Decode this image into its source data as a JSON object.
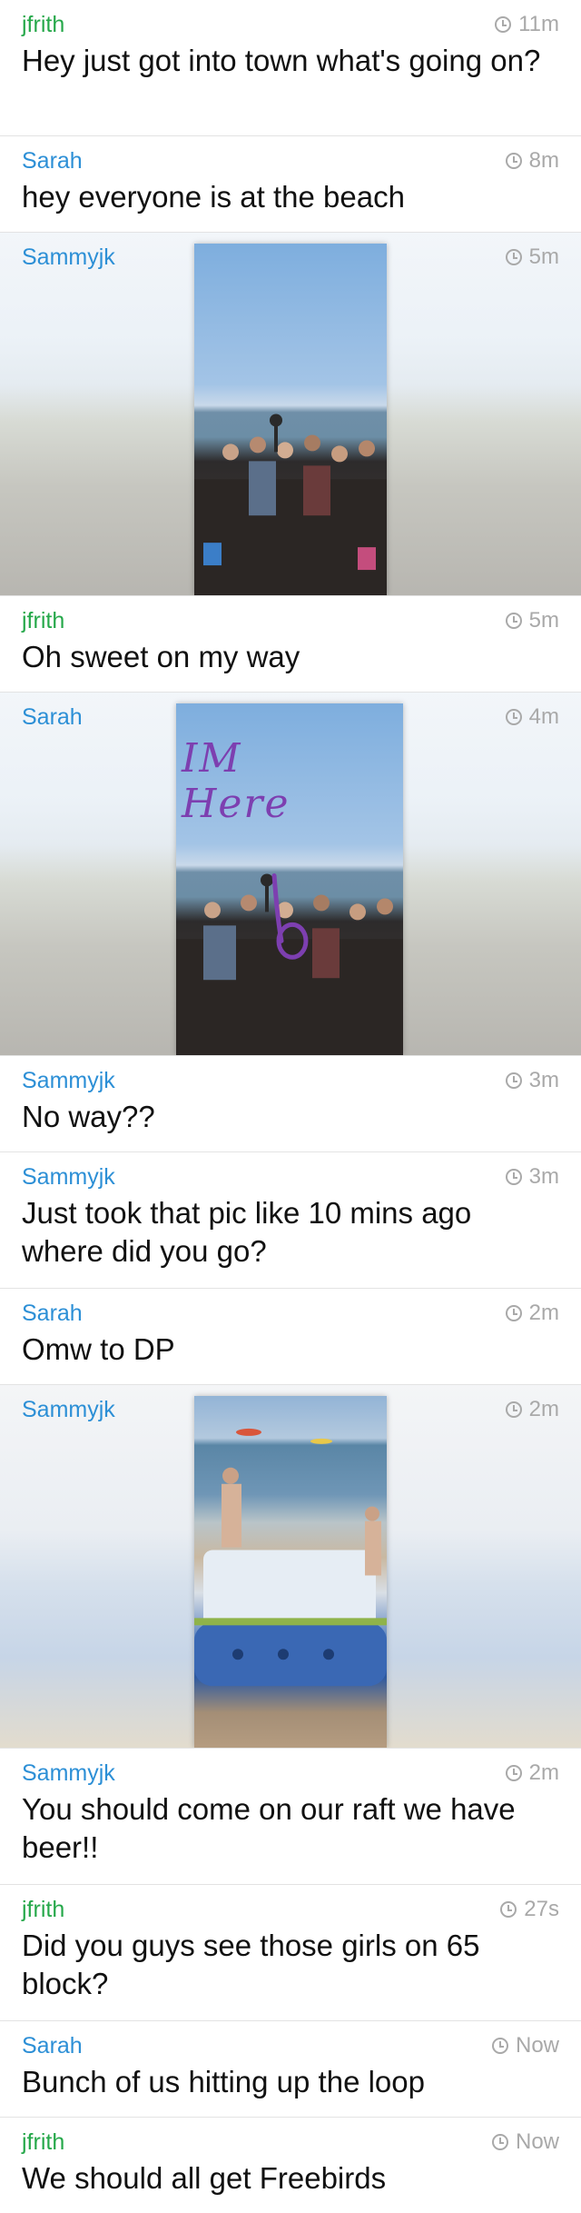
{
  "colors": {
    "green_user": "#26a84a",
    "blue_user": "#2c8fd6",
    "time_gray": "#a9a9a9"
  },
  "posts": [
    {
      "user": "jfrith",
      "time": "11m",
      "text": "Hey just got into town what's going on?"
    },
    {
      "user": "Sarah",
      "time": "8m",
      "text": "hey everyone is at the beach"
    },
    {
      "user": "Sammyjk",
      "time": "5m",
      "image": "beach-crowd-photo"
    },
    {
      "user": "jfrith",
      "time": "5m",
      "text": "Oh sweet on my way"
    },
    {
      "user": "Sarah",
      "time": "4m",
      "image": "beach-crowd-photo-with-drawing",
      "handwriting": "IM Here"
    },
    {
      "user": "Sammyjk",
      "time": "3m",
      "text": "No way??"
    },
    {
      "user": "Sammyjk",
      "time": "3m",
      "text": "Just took that pic like 10 mins ago where did you go?"
    },
    {
      "user": "Sarah",
      "time": "2m",
      "text": "Omw to DP"
    },
    {
      "user": "Sammyjk",
      "time": "2m",
      "image": "raft-on-beach-photo"
    },
    {
      "user": "Sammyjk",
      "time": "2m",
      "text": "You should come on our raft we have beer!!"
    },
    {
      "user": "jfrith",
      "time": "27s",
      "text": "Did you guys see those girls on 65 block?"
    },
    {
      "user": "Sarah",
      "time": "Now",
      "text": "Bunch of us hitting up the loop"
    },
    {
      "user": "jfrith",
      "time": "Now",
      "text": "We should all get Freebirds"
    }
  ]
}
